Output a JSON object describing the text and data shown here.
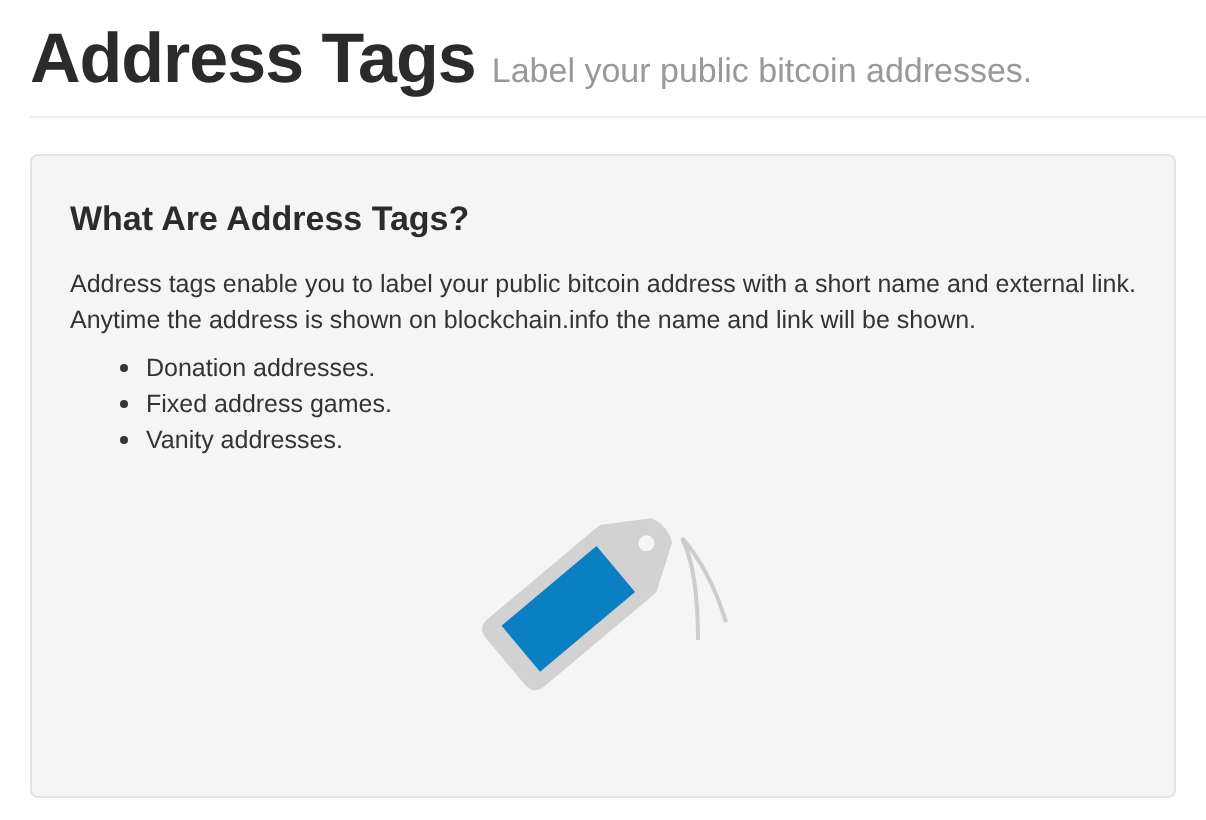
{
  "header": {
    "title": "Address Tags",
    "subtitle": "Label your public bitcoin addresses."
  },
  "panel": {
    "heading": "What Are Address Tags?",
    "description": "Address tags enable you to label your public bitcoin address with a short name and external link. Anytime the address is shown on blockchain.info the name and link will be shown.",
    "uses": [
      "Donation addresses.",
      "Fixed address games.",
      "Vanity addresses."
    ]
  }
}
